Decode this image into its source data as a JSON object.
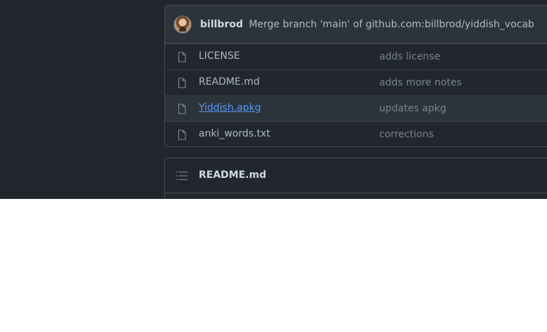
{
  "latest_commit": {
    "author": "billbrod",
    "message": "Merge branch 'main' of github.com:billbrod/yiddish_vocab"
  },
  "files": [
    {
      "name": "LICENSE",
      "message": "adds license"
    },
    {
      "name": "README.md",
      "message": "adds more notes"
    },
    {
      "name": "Yiddish.apkg",
      "message": "updates apkg"
    },
    {
      "name": "anki_words.txt",
      "message": "corrections"
    }
  ],
  "readme": {
    "title": "README.md"
  },
  "icons": {
    "avatar": "user-avatar",
    "file": "file-icon",
    "readme": "list-icon"
  },
  "colors": {
    "background": "#22272e",
    "border": "#444c56",
    "link": "#539bf5",
    "muted": "#768390",
    "text": "#adbac7"
  }
}
